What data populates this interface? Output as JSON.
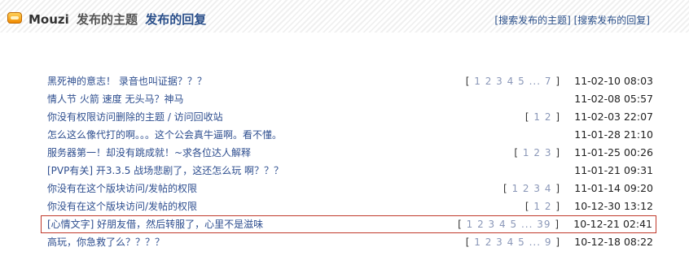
{
  "header": {
    "username": "Mouzi",
    "tab_threads": "发布的主题",
    "tab_replies": "发布的回复",
    "search_threads": "[搜索发布的主题]",
    "search_replies": "[搜索发布的回复]"
  },
  "threads": [
    {
      "title": "黑死神的意志！ 录音也叫证据？？？",
      "pages": [
        "1",
        "2",
        "3",
        "4",
        "5",
        "...",
        "7"
      ],
      "date": "11-02-10 08:03"
    },
    {
      "title": "情人节 火箭 速度 无头马？神马",
      "pages": [],
      "date": "11-02-08 05:57"
    },
    {
      "title": "你没有权限访问删除的主题 / 访问回收站",
      "pages": [
        "1",
        "2"
      ],
      "date": "11-02-03 22:07"
    },
    {
      "title": "怎么这么像代打的啊。。。这个公会真牛逼啊。看不懂。",
      "pages": [],
      "date": "11-01-28 21:10"
    },
    {
      "title": "服务器第一！却没有跳成就！~求各位达人解释",
      "pages": [
        "1",
        "2",
        "3"
      ],
      "date": "11-01-25 00:26"
    },
    {
      "title": "[PVP有关] 开3.3.5 战场悲剧了，这还怎么玩 啊？？？",
      "pages": [],
      "date": "11-01-21 09:31"
    },
    {
      "title": "你没有在这个版块访问/发帖的权限",
      "pages": [
        "1",
        "2",
        "3",
        "4"
      ],
      "date": "11-01-14 09:20"
    },
    {
      "title": "你没有在这个版块访问/发帖的权限",
      "pages": [
        "1",
        "2"
      ],
      "date": "10-12-30 13:12"
    },
    {
      "title": "[心情文字] 好朋友借，然后转服了，心里不是滋味",
      "pages": [
        "1",
        "2",
        "3",
        "4",
        "5",
        "...",
        "39"
      ],
      "date": "10-12-21 02:41",
      "highlighted": true
    },
    {
      "title": "高玩，你急救了么？？？？",
      "pages": [
        "1",
        "2",
        "3",
        "4",
        "5",
        "...",
        "9"
      ],
      "date": "10-12-18 08:22"
    }
  ]
}
